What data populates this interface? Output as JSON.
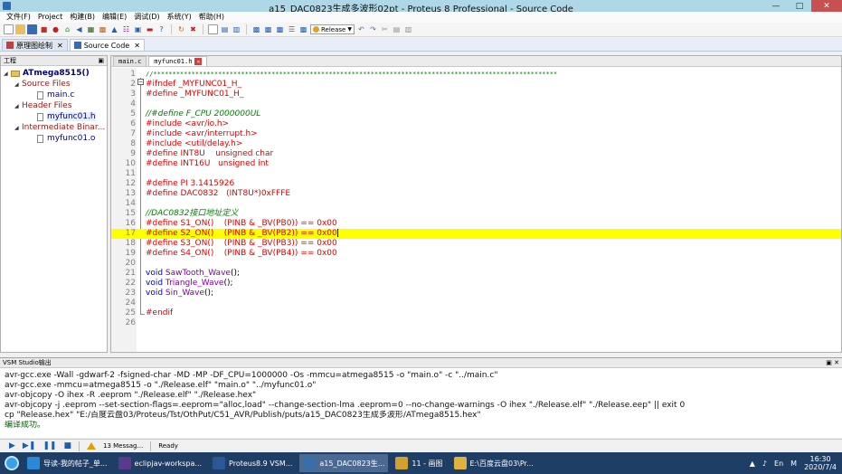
{
  "window": {
    "title": "a15_DAC0823生成多波形02pt - Proteus 8 Professional - Source Code"
  },
  "menu": [
    "文件(F)",
    "Project",
    "构建(B)",
    "编辑(E)",
    "调试(D)",
    "系统(Y)",
    "帮助(H)"
  ],
  "toolbar": {
    "build_config": "Release"
  },
  "main_tabs": [
    {
      "label": "原理图绘制",
      "active": false
    },
    {
      "label": "Source Code",
      "active": true
    }
  ],
  "project_panel": {
    "title": "工程",
    "root": "ATmega8515()",
    "groups": [
      {
        "label": "Source Files",
        "files": [
          "main.c"
        ]
      },
      {
        "label": "Header Files",
        "files": [
          "myfunc01.h"
        ]
      },
      {
        "label": "Intermediate Binar...",
        "files": [
          "myfunc01.o"
        ]
      }
    ]
  },
  "editor": {
    "tabs": [
      {
        "label": "main.c",
        "active": false
      },
      {
        "label": "myfunc01.h",
        "active": true
      }
    ],
    "highlight_line": 17,
    "lines": [
      {
        "n": "1",
        "t": "//**********************************************************************************************************",
        "k": "star"
      },
      {
        "n": "2",
        "t": "#ifndef _MYFUNC01_H_",
        "k": "dir"
      },
      {
        "n": "3",
        "t": "#define _MYFUNC01_H_",
        "k": "dir"
      },
      {
        "n": "4",
        "t": "",
        "k": ""
      },
      {
        "n": "5",
        "t": "//#define F_CPU 2000000UL",
        "k": "com"
      },
      {
        "n": "6",
        "t": "#include <avr/io.h>",
        "k": "dir"
      },
      {
        "n": "7",
        "t": "#include <avr/interrupt.h>",
        "k": "dir"
      },
      {
        "n": "8",
        "t": "#include <util/delay.h>",
        "k": "dir"
      },
      {
        "n": "9",
        "t": "#define INT8U    unsigned char",
        "k": "dir"
      },
      {
        "n": "10",
        "t": "#define INT16U   unsigned int",
        "k": "dir"
      },
      {
        "n": "11",
        "t": "",
        "k": ""
      },
      {
        "n": "12",
        "t": "#define PI 3.1415926",
        "k": "dir"
      },
      {
        "n": "13",
        "t": "#define DAC0832   (INT8U*)0xFFFE",
        "k": "dir"
      },
      {
        "n": "14",
        "t": "",
        "k": ""
      },
      {
        "n": "15",
        "t": "//DAC0832接口地址定义",
        "k": "com"
      },
      {
        "n": "16",
        "t": "#define S1_ON()    (PINB & _BV(PB0)) == 0x00",
        "k": "dir"
      },
      {
        "n": "17",
        "t": "#define S2_ON()    (PINB & _BV(PB2)) == 0x00",
        "k": "dir"
      },
      {
        "n": "18",
        "t": "#define S3_ON()    (PINB & _BV(PB3)) == 0x00",
        "k": "dir"
      },
      {
        "n": "19",
        "t": "#define S4_ON()    (PINB & _BV(PB4)) == 0x00",
        "k": "dir"
      },
      {
        "n": "20",
        "t": "",
        "k": ""
      },
      {
        "n": "21",
        "kw": "void",
        "fn": "SawTooth_Wave",
        "p": "();"
      },
      {
        "n": "22",
        "kw": "void",
        "fn": "Triangle_Wave",
        "p": "();"
      },
      {
        "n": "23",
        "kw": "void",
        "fn": "Sin_Wave",
        "p": "();"
      },
      {
        "n": "24",
        "t": "",
        "k": ""
      },
      {
        "n": "25",
        "t": "#endif",
        "k": "dir"
      },
      {
        "n": "26",
        "t": "",
        "k": ""
      }
    ]
  },
  "output": {
    "title": "VSM Studio输出",
    "lines": [
      "avr-gcc.exe -Wall -gdwarf-2 -fsigned-char -MD -MP -DF_CPU=1000000 -Os -mmcu=atmega8515  -o \"main.o\" -c \"../main.c\"",
      "avr-gcc.exe -mmcu=atmega8515  -o \"./Release.elf\" \"main.o\" \"../myfunc01.o\"",
      "avr-objcopy -O ihex -R .eeprom \"./Release.elf\" \"./Release.hex\"",
      "avr-objcopy -j .eeprom --set-section-flags=.eeprom=\"alloc,load\" --change-section-lma .eeprom=0 --no-change-warnings -O ihex \"./Release.elf\" \"./Release.eep\" || exit 0",
      "cp \"Release.hex\" \"E:/百度云盘03/Proteus/Tst/OthPut/C51_AVR/Publish/puts/a15_DAC0823生成多波形/ATmega8515.hex\""
    ],
    "success": "编译成功。"
  },
  "status": {
    "messages": "13 Messag...",
    "state": "Ready"
  },
  "taskbar": {
    "items": [
      {
        "label": "导读-我的帖子_单...",
        "color": "#2b8ad8"
      },
      {
        "label": "eclipjav-workspa...",
        "color": "#5a3a8a"
      },
      {
        "label": "Proteus8.9 VSM...",
        "color": "#2b5797"
      },
      {
        "label": "a15_DAC0823生...",
        "color": "#3a6ea8"
      },
      {
        "label": "11 - 画图",
        "color": "#d0a030"
      },
      {
        "label": "E:\\百度云盘03\\Pr...",
        "color": "#e0b040"
      }
    ],
    "active_index": 3,
    "ime": "En",
    "ime_mode": "M",
    "time": "16:30",
    "date": "2020/7/4"
  }
}
